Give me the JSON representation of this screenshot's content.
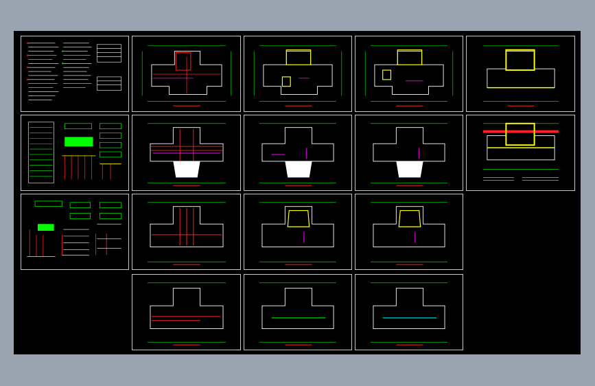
{
  "viewport": {
    "background": "#9aa4b1",
    "canvas_background": "#000000"
  },
  "colors": {
    "frame": "#c8c8c8",
    "wall": "#ffff00",
    "dim": "#00ff00",
    "pipe_red": "#ff2020",
    "pipe_magenta": "#ff00ff",
    "text_white": "#ffffff",
    "cyan": "#00ffff"
  },
  "sheets": [
    {
      "id": "notes-sheet",
      "kind": "notes"
    },
    {
      "id": "legend-sheet-1",
      "kind": "legend"
    },
    {
      "id": "legend-sheet-2",
      "kind": "legend"
    },
    {
      "id": "plan-r1-c1",
      "kind": "plan-top"
    },
    {
      "id": "plan-r1-c2",
      "kind": "plan-top"
    },
    {
      "id": "plan-r1-c3",
      "kind": "plan-top"
    },
    {
      "id": "plan-r1-c4",
      "kind": "roof"
    },
    {
      "id": "plan-r2-c1",
      "kind": "plan-stair"
    },
    {
      "id": "plan-r2-c2",
      "kind": "plan-stair"
    },
    {
      "id": "plan-r2-c3",
      "kind": "plan-stair"
    },
    {
      "id": "plan-r2-c4",
      "kind": "roof-detail"
    },
    {
      "id": "plan-r3-c1",
      "kind": "plan-mid"
    },
    {
      "id": "plan-r3-c2",
      "kind": "plan-mid"
    },
    {
      "id": "plan-r3-c3",
      "kind": "plan-mid"
    },
    {
      "id": "plan-r4-c1",
      "kind": "plan-low"
    },
    {
      "id": "plan-r4-c2",
      "kind": "plan-low"
    },
    {
      "id": "plan-r4-c3",
      "kind": "plan-low"
    }
  ]
}
